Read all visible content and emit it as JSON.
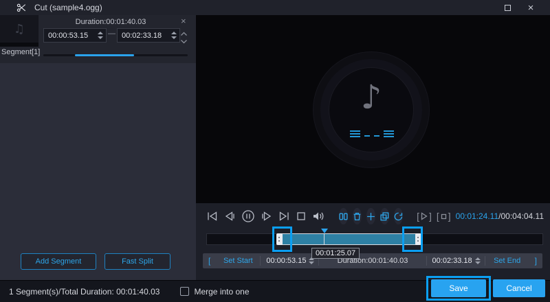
{
  "window": {
    "title": "Cut (sample4.ogg)"
  },
  "segment_panel": {
    "segment_label": "Segment[1]",
    "duration_label": "Duration:00:01:40.03",
    "start_value": "00:00:53.15",
    "separator": "—",
    "end_value": "00:02:33.18",
    "add_segment_label": "Add Segment",
    "fast_split_label": "Fast Split"
  },
  "player": {
    "time_current": "00:01:24.11",
    "time_total": "/00:04:04.11"
  },
  "timeline": {
    "playhead_time": "00:01:25.07",
    "sel_start_pct": 21.8,
    "sel_end_pct": 62.9,
    "playhead_pct": 35.0
  },
  "trim_bar": {
    "bracket_open": "[",
    "set_start_label": "Set Start",
    "start_value": "00:00:53.15",
    "duration_label": "Duration:00:01:40.03",
    "end_value": "00:02:33.18",
    "set_end_label": "Set End",
    "bracket_close": "]"
  },
  "footer": {
    "summary": "1 Segment(s)/Total Duration: 00:01:40.03",
    "merge_label": "Merge into one",
    "save_label": "Save",
    "cancel_label": "Cancel"
  },
  "colors": {
    "accent": "#2aa3ec",
    "selection": "#2e80a4",
    "highlight": "#0b9ff2"
  }
}
